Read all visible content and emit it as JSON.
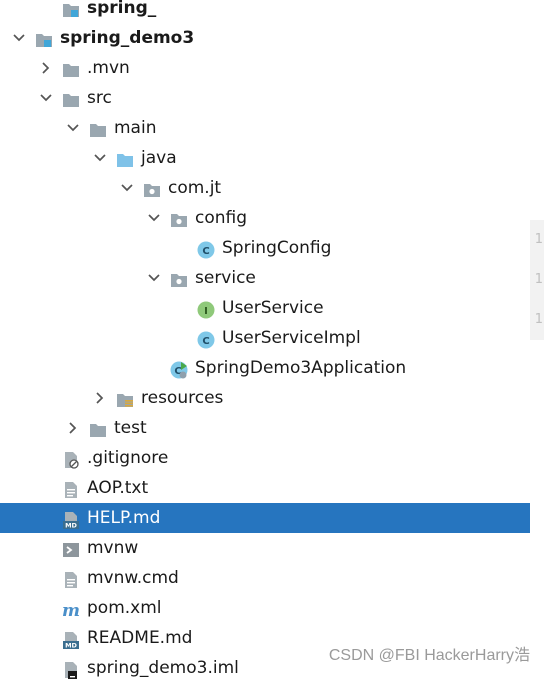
{
  "tree": {
    "rows": [
      {
        "label": "spring_",
        "level": 2,
        "arrow": "none",
        "icon": "module",
        "bold": true
      },
      {
        "label": "spring_demo3",
        "level": 1,
        "arrow": "down",
        "icon": "module",
        "bold": true
      },
      {
        "label": ".mvn",
        "level": 2,
        "arrow": "right",
        "icon": "folder"
      },
      {
        "label": "src",
        "level": 2,
        "arrow": "down",
        "icon": "folder"
      },
      {
        "label": "main",
        "level": 3,
        "arrow": "down",
        "icon": "folder"
      },
      {
        "label": "java",
        "level": 4,
        "arrow": "down",
        "icon": "folder-source"
      },
      {
        "label": "com.jt",
        "level": 5,
        "arrow": "down",
        "icon": "package"
      },
      {
        "label": "config",
        "level": 6,
        "arrow": "down",
        "icon": "package"
      },
      {
        "label": "SpringConfig",
        "level": 7,
        "arrow": "none",
        "icon": "class"
      },
      {
        "label": "service",
        "level": 6,
        "arrow": "down",
        "icon": "package"
      },
      {
        "label": "UserService",
        "level": 7,
        "arrow": "none",
        "icon": "interface"
      },
      {
        "label": "UserServiceImpl",
        "level": 7,
        "arrow": "none",
        "icon": "class"
      },
      {
        "label": "SpringDemo3Application",
        "level": 6,
        "arrow": "none",
        "icon": "spring-app"
      },
      {
        "label": "resources",
        "level": 4,
        "arrow": "right",
        "icon": "folder-resources"
      },
      {
        "label": "test",
        "level": 3,
        "arrow": "right",
        "icon": "folder"
      },
      {
        "label": ".gitignore",
        "level": 2,
        "arrow": "none",
        "icon": "gitignore-file"
      },
      {
        "label": "AOP.txt",
        "level": 2,
        "arrow": "none",
        "icon": "text-file"
      },
      {
        "label": "HELP.md",
        "level": 2,
        "arrow": "none",
        "icon": "markdown-file",
        "selected": true
      },
      {
        "label": "mvnw",
        "level": 2,
        "arrow": "none",
        "icon": "shell-file"
      },
      {
        "label": "mvnw.cmd",
        "level": 2,
        "arrow": "none",
        "icon": "text-file"
      },
      {
        "label": "pom.xml",
        "level": 2,
        "arrow": "none",
        "icon": "maven-file"
      },
      {
        "label": "README.md",
        "level": 2,
        "arrow": "none",
        "icon": "markdown-file"
      },
      {
        "label": "spring_demo3.iml",
        "level": 2,
        "arrow": "none",
        "icon": "iml-file"
      }
    ]
  },
  "gutter_marks": [
    "1",
    "1",
    "1"
  ],
  "watermark": "CSDN @FBI HackerHarry浩",
  "colors": {
    "selection": "#2675bf",
    "folder": "#9aa7b0",
    "source_folder": "#7fc2e8",
    "class_icon": "#7fc8e8",
    "interface_icon": "#8fc97a"
  }
}
